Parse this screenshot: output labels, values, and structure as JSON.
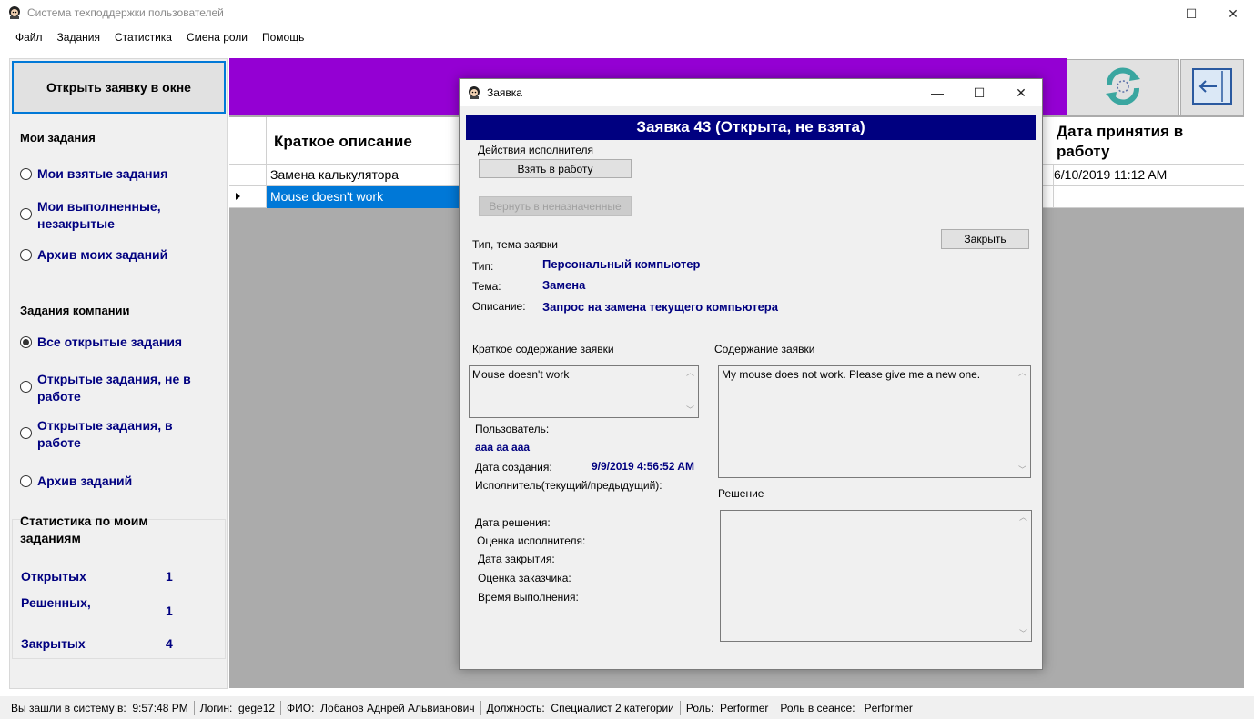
{
  "window": {
    "title": "Система техподдержки пользователей",
    "minimize_glyph": "—",
    "maximize_glyph": "☐",
    "close_glyph": "✕"
  },
  "menu": [
    "Файл",
    "Задания",
    "Статистика",
    "Смена роли",
    "Помощь"
  ],
  "left_panel": {
    "open_button": "Открыть заявку в окне",
    "my_tasks_title": "Мои задания",
    "my_tasks": [
      {
        "label": "Мои взятые задания",
        "selected": false
      },
      {
        "label": "Мои выполненные, незакрытые",
        "selected": false
      },
      {
        "label": "Архив моих заданий",
        "selected": false
      }
    ],
    "company_tasks_title": "Задания компании",
    "company_tasks": [
      {
        "label": "Все открытые задания",
        "selected": true
      },
      {
        "label": "Открытые задания, не в работе",
        "selected": false
      },
      {
        "label": "Открытые задания, в работе",
        "selected": false
      },
      {
        "label": "Архив заданий",
        "selected": false
      }
    ],
    "stats_title": "Статистика по моим заданиям",
    "stats": [
      {
        "label": "Открытых",
        "value": "1"
      },
      {
        "label": "Решенных,",
        "value": "1"
      },
      {
        "label": "Закрытых",
        "value": "4"
      }
    ]
  },
  "toolbar": {
    "accent_color": "#9400d3",
    "refresh_icon": "refresh-icon",
    "back_icon": "back-arrow-icon"
  },
  "grid": {
    "columns": [
      "Краткое описание",
      "Дата принятия в работу"
    ],
    "rows": [
      {
        "desc": "Замена калькулятора",
        "date": "6/10/2019 11:12 AM",
        "selected": false
      },
      {
        "desc": "Mouse doesn't work",
        "date": "",
        "selected": true
      }
    ]
  },
  "dialog": {
    "title": "Заявка",
    "header": "Заявка 43 (Открыта, не взята)",
    "header_color": "#000080",
    "actions_label": "Действия исполнителя",
    "take_button": "Взять в работу",
    "return_button": "Вернуть в неназначенные",
    "close_button": "Закрыть",
    "type_section": "Тип, тема заявки",
    "type_label": "Тип:",
    "type_value": "Персональный компьютер",
    "topic_label": "Тема:",
    "topic_value": "Замена",
    "desc_label": "Описание:",
    "desc_value": "Запрос на замена текущего компьютера",
    "short_content_label": "Краткое содержание заявки",
    "short_content_value": "Mouse doesn't work",
    "content_label": "Содержание заявки",
    "content_value": "My mouse does not work. Please give me a new one.",
    "user_label": "Пользователь:",
    "user_value": "aaa aa aaa",
    "created_label": "Дата создания:",
    "created_value": "9/9/2019 4:56:52 AM",
    "performer_label": "Исполнитель(текущий/предыдущий):",
    "solution_label": "Решение",
    "solution_date_label": "Дата решения:",
    "performer_rating_label": "Оценка исполнителя:",
    "close_date_label": "Дата закрытия:",
    "customer_rating_label": "Оценка заказчика:",
    "exec_time_label": "Время выполнения:"
  },
  "statusbar": {
    "login_time_label": "Вы зашли в систему в:",
    "login_time": "9:57:48 PM",
    "login_label": "Логин:",
    "login": "gege12",
    "fio_label": "ФИО:",
    "fio": "Лобанов Аднрей Альвианович",
    "position_label": "Должность:",
    "position": "Специалист 2 категории",
    "role_label": "Роль:",
    "role": "Performer",
    "session_role_label": "Роль в сеансе:",
    "session_role": "Performer"
  }
}
